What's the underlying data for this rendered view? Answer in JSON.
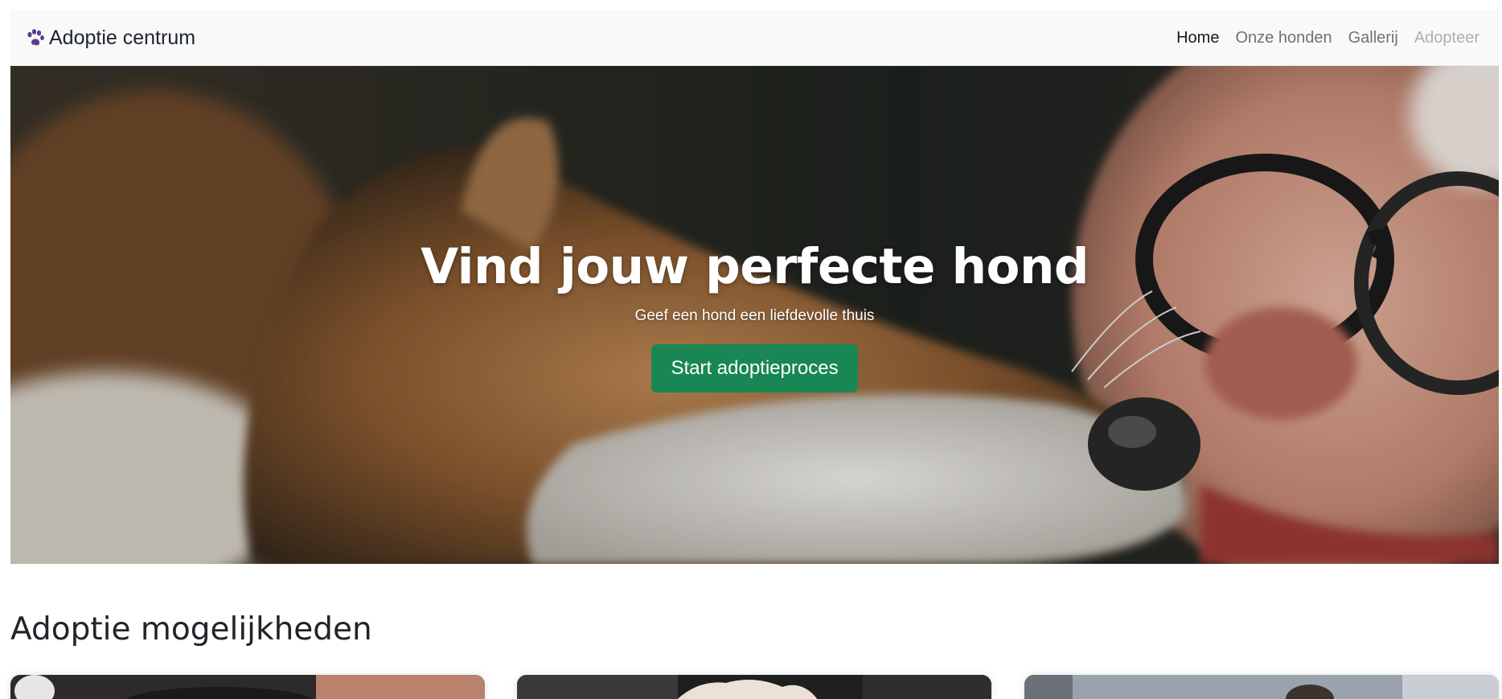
{
  "navbar": {
    "brand": "Adoptie centrum",
    "brand_icon": "paw-icon",
    "items": [
      {
        "label": "Home",
        "state": "active"
      },
      {
        "label": "Onze honden",
        "state": "default"
      },
      {
        "label": "Gallerij",
        "state": "default"
      },
      {
        "label": "Adopteer",
        "state": "disabled"
      }
    ]
  },
  "hero": {
    "title": "Vind jouw perfecte hond",
    "subtitle": "Geef een hond een liefdevolle thuis",
    "cta_label": "Start adoptieproces",
    "cta_color": "#198754"
  },
  "section": {
    "title": "Adoptie mogelijkheden",
    "cards": [
      {
        "image": "dog-photo"
      },
      {
        "image": "dog-photo"
      },
      {
        "image": "dog-photo"
      }
    ]
  }
}
